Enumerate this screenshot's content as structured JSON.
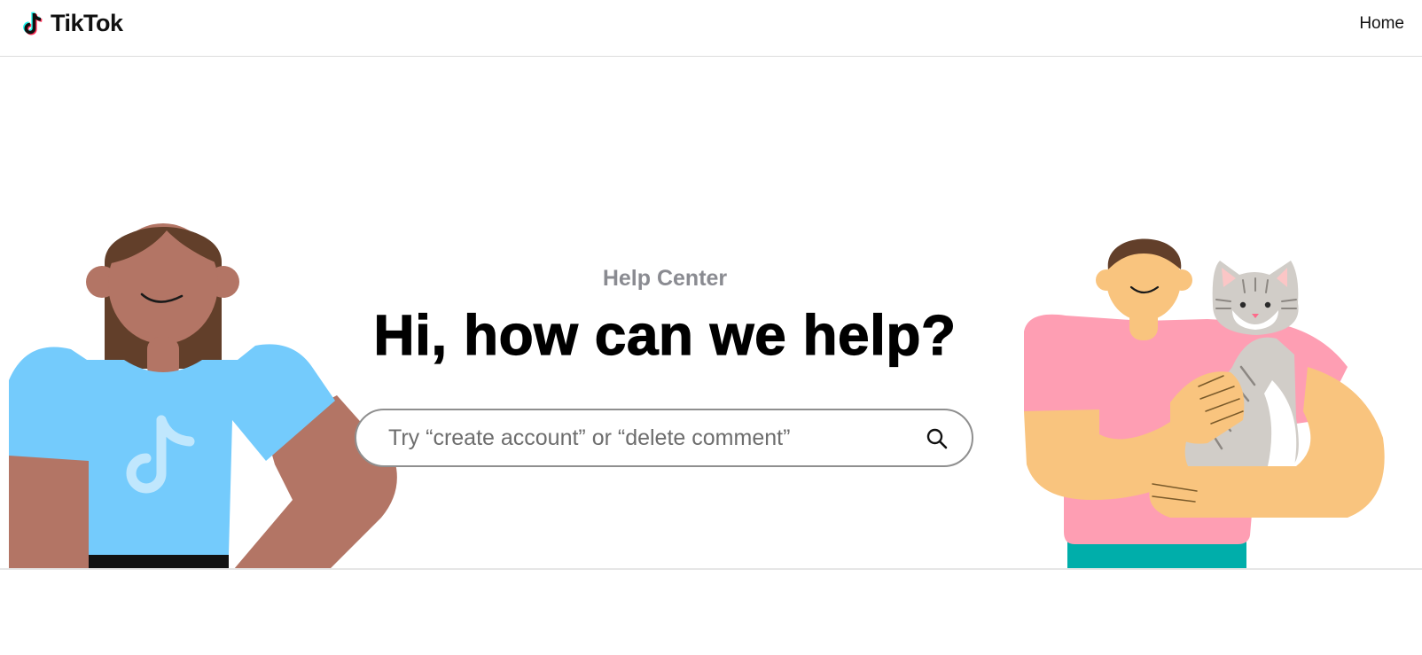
{
  "header": {
    "brand_name": "TikTok",
    "logo_icon": "tiktok-note-icon",
    "nav_home_label": "Home"
  },
  "hero": {
    "eyebrow": "Help Center",
    "title": "Hi, how can we help?",
    "search": {
      "placeholder": "Try “create account” or “delete comment”",
      "value": "",
      "icon": "search-icon"
    }
  },
  "colors": {
    "brand_cyan": "#25F4EE",
    "brand_red": "#FE2C55",
    "text_primary": "#000000",
    "text_secondary": "#8A8B91",
    "search_border": "#8F8F8F",
    "shirt_blue": "#74CBFC",
    "shirt_pink": "#FE9EB3",
    "pants_teal": "#00AEAA"
  }
}
